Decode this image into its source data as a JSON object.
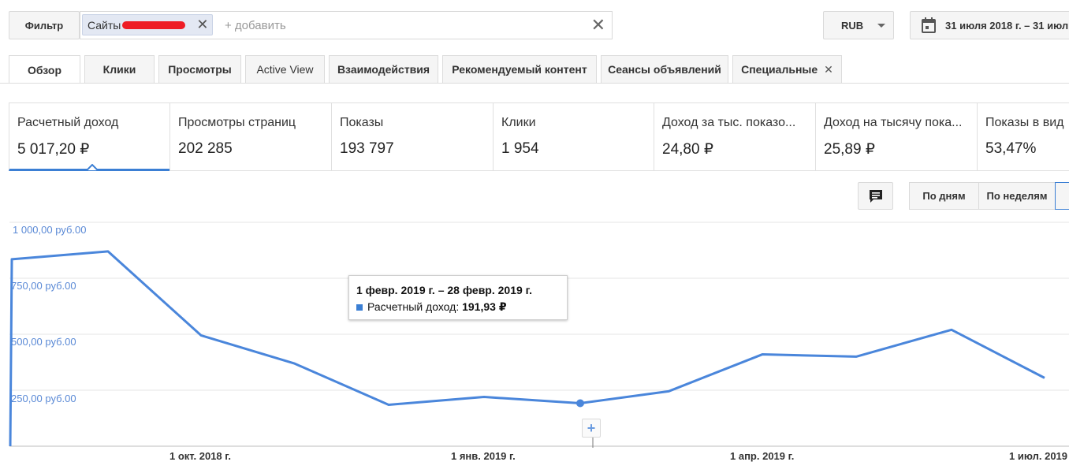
{
  "toolbar": {
    "filter_label": "Фильтр",
    "chip_label": "Сайты",
    "chip_close": "✕",
    "add_placeholder": "+ добавить",
    "clear": "✕",
    "currency": "RUB",
    "date_range": "31 июля 2018 г. – 31 июл"
  },
  "tabs": [
    {
      "label": "Обзор"
    },
    {
      "label": "Клики"
    },
    {
      "label": "Просмотры"
    },
    {
      "label": "Active View"
    },
    {
      "label": "Взаимодействия"
    },
    {
      "label": "Рекомендуемый контент"
    },
    {
      "label": "Сеансы объявлений"
    },
    {
      "label": "Специальные"
    }
  ],
  "special_close": "✕",
  "metrics": [
    {
      "label": "Расчетный доход",
      "value": "5 017,20 ₽"
    },
    {
      "label": "Просмотры страниц",
      "value": "202 285"
    },
    {
      "label": "Показы",
      "value": "193 797"
    },
    {
      "label": "Клики",
      "value": "1 954"
    },
    {
      "label": "Доход за тыс. показо...",
      "value": "24,80 ₽"
    },
    {
      "label": "Доход на тысячу пока...",
      "value": "25,89 ₽"
    },
    {
      "label": "Показы в вид",
      "value": "53,47%"
    }
  ],
  "view_controls": {
    "by_days": "По дням",
    "by_weeks": "По неделям",
    "comment_icon": "comment-icon"
  },
  "tooltip": {
    "range": "1 февр. 2019 г. – 28 февр. 2019 г.",
    "series": "Расчетный доход:",
    "value": "191,93 ₽"
  },
  "plus": "+",
  "colors": {
    "line": "#4a86db",
    "accent": "#3b7fd4"
  },
  "chart_data": {
    "type": "line",
    "ylabel_ticks": [
      "1 000,00 руб.00",
      "750,00 руб.00",
      "500,00 руб.00",
      "250,00 руб.00"
    ],
    "x_tick_labels": [
      "1 окт. 2018 г.",
      "1 янв. 2019 г.",
      "1 апр. 2019 г.",
      "1 июл. 2019"
    ],
    "ylim": [
      0,
      1000
    ],
    "series": [
      {
        "name": "Расчетный доход",
        "values": [
          0,
          835,
          870,
          495,
          370,
          185,
          220,
          191.93,
          245,
          410,
          400,
          520,
          305
        ]
      }
    ],
    "grid": true,
    "highlight_index": 7
  }
}
